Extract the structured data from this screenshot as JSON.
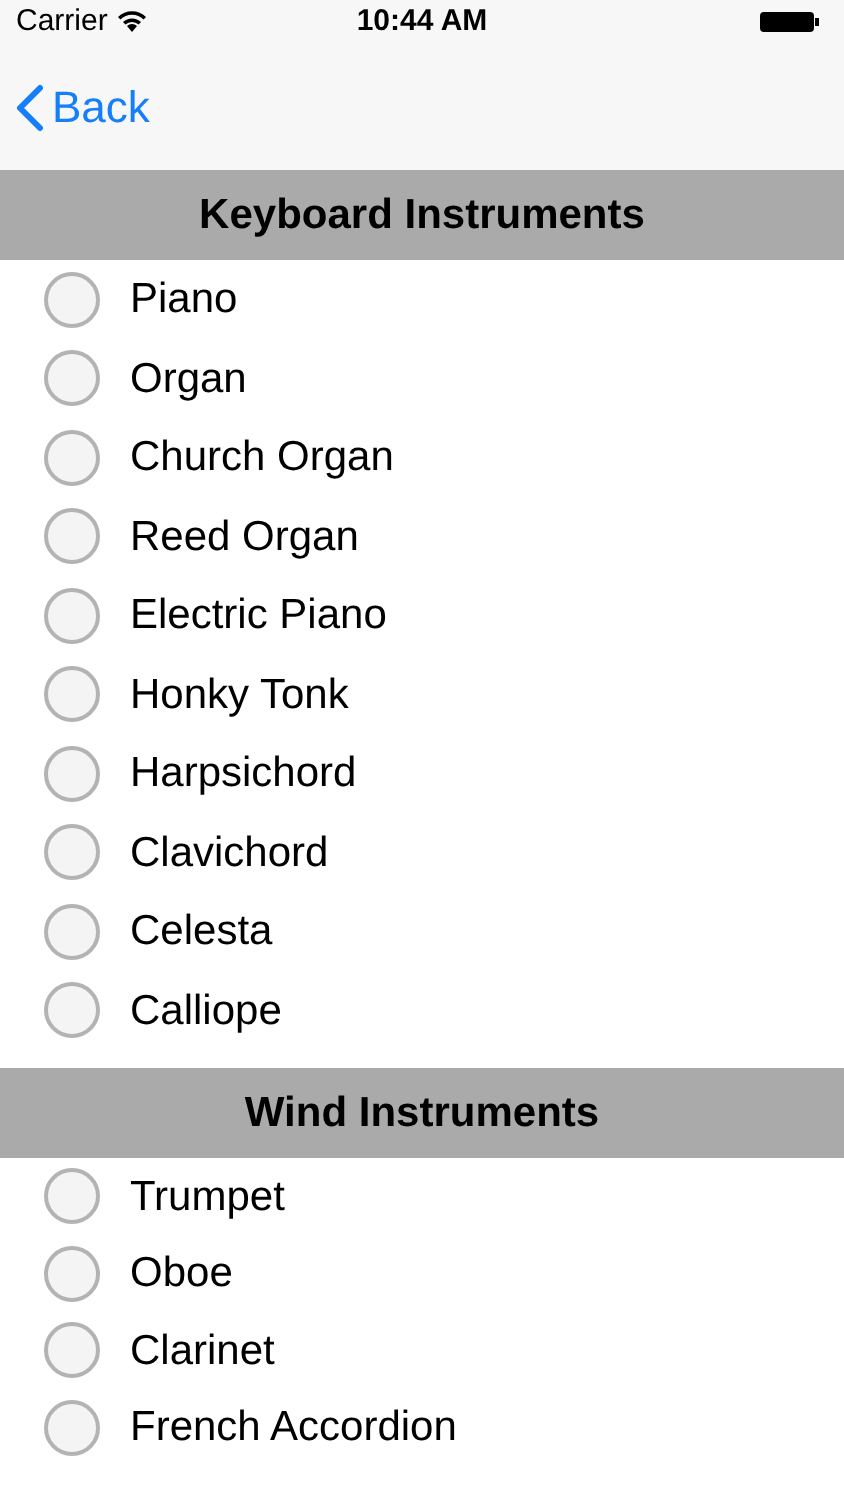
{
  "status_bar": {
    "carrier": "Carrier",
    "time": "10:44 AM"
  },
  "nav_bar": {
    "back": "Back"
  },
  "sections": [
    {
      "title": "Keyboard Instruments",
      "items": [
        {
          "label": "Piano",
          "selected": false
        },
        {
          "label": "Organ",
          "selected": false
        },
        {
          "label": "Church Organ",
          "selected": false
        },
        {
          "label": "Reed Organ",
          "selected": false
        },
        {
          "label": "Electric Piano",
          "selected": false
        },
        {
          "label": "Honky Tonk",
          "selected": false
        },
        {
          "label": "Harpsichord",
          "selected": false
        },
        {
          "label": "Clavichord",
          "selected": false
        },
        {
          "label": "Celesta",
          "selected": false
        },
        {
          "label": "Calliope",
          "selected": false
        }
      ]
    },
    {
      "title": "Wind Instruments",
      "items": [
        {
          "label": "Trumpet",
          "selected": false
        },
        {
          "label": "Oboe",
          "selected": false
        },
        {
          "label": "Clarinet",
          "selected": false
        },
        {
          "label": "French Accordion",
          "selected": false
        }
      ]
    }
  ]
}
